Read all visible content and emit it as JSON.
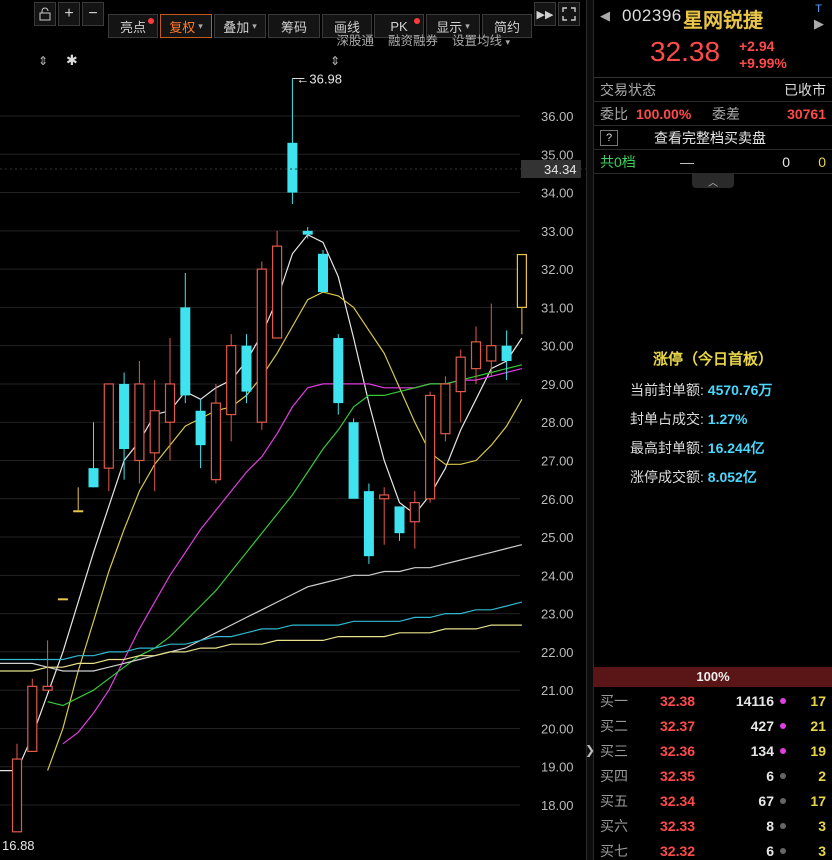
{
  "toolbar": {
    "buttons": [
      {
        "label": "亮点",
        "dot": true,
        "active": false,
        "caret": false
      },
      {
        "label": "复权",
        "dot": false,
        "active": true,
        "caret": true
      },
      {
        "label": "叠加",
        "dot": false,
        "active": false,
        "caret": true
      },
      {
        "label": "筹码",
        "dot": false,
        "active": false,
        "caret": false
      },
      {
        "label": "画线",
        "dot": false,
        "active": false,
        "caret": false
      },
      {
        "label": "PK",
        "dot": true,
        "active": false,
        "caret": false
      },
      {
        "label": "显示",
        "dot": false,
        "active": false,
        "caret": true
      },
      {
        "label": "简约",
        "dot": false,
        "active": false,
        "caret": false
      }
    ],
    "sub_links": [
      "深股通",
      "融资融券",
      "设置均线"
    ]
  },
  "chart_data": {
    "type": "candlestick",
    "y_axis_ticks": [
      36.0,
      35.0,
      34.0,
      33.0,
      32.0,
      31.0,
      30.0,
      29.0,
      28.0,
      27.0,
      26.0,
      25.0,
      24.0,
      23.0,
      22.0,
      21.0,
      20.0,
      19.0,
      18.0
    ],
    "ylim": [
      17.3,
      38.25
    ],
    "current_price_marker": "34.34",
    "high_annotation": "36.98",
    "low_label": "16.88",
    "colors": {
      "up": "#ff4a4a",
      "down": "#3fe3ef",
      "flat": "#e8c547",
      "ma5": "#e6e6e6",
      "ma10": "#d8c84a",
      "ma20": "#e03ee0",
      "ma30": "#37c83a",
      "ma60": "#d0d0d0",
      "ma120": "#2fb8cf",
      "ma250": "#e8e18c"
    },
    "candles": [
      {
        "o": 17.3,
        "h": 19.6,
        "l": 17.3,
        "c": 19.2
      },
      {
        "o": 19.4,
        "h": 21.3,
        "l": 19.4,
        "c": 21.1
      },
      {
        "o": 21.0,
        "h": 22.3,
        "l": 21.0,
        "c": 21.1
      },
      {
        "o": 23.4,
        "h": 23.4,
        "l": 23.4,
        "c": 23.4
      },
      {
        "o": 25.7,
        "h": 26.3,
        "l": 25.7,
        "c": 25.7
      },
      {
        "o": 26.8,
        "h": 28.0,
        "l": 26.3,
        "c": 26.3
      },
      {
        "o": 26.8,
        "h": 28.3,
        "l": 26.2,
        "c": 29.0
      },
      {
        "o": 29.0,
        "h": 29.3,
        "l": 26.5,
        "c": 27.3
      },
      {
        "o": 27.0,
        "h": 29.6,
        "l": 26.4,
        "c": 29.0
      },
      {
        "o": 27.2,
        "h": 29.1,
        "l": 26.2,
        "c": 28.3
      },
      {
        "o": 28.0,
        "h": 30.2,
        "l": 27.0,
        "c": 29.0
      },
      {
        "o": 31.0,
        "h": 31.9,
        "l": 28.5,
        "c": 28.7
      },
      {
        "o": 28.3,
        "h": 28.6,
        "l": 26.8,
        "c": 27.4
      },
      {
        "o": 26.5,
        "h": 29.0,
        "l": 26.4,
        "c": 28.5
      },
      {
        "o": 28.2,
        "h": 30.3,
        "l": 27.5,
        "c": 30.0
      },
      {
        "o": 30.0,
        "h": 30.3,
        "l": 28.5,
        "c": 28.8
      },
      {
        "o": 28.0,
        "h": 32.2,
        "l": 27.8,
        "c": 32.0
      },
      {
        "o": 30.2,
        "h": 33.0,
        "l": 30.2,
        "c": 32.6
      },
      {
        "o": 35.3,
        "h": 36.98,
        "l": 33.7,
        "c": 34.0
      },
      {
        "o": 33.0,
        "h": 33.1,
        "l": 32.8,
        "c": 32.9
      },
      {
        "o": 32.4,
        "h": 32.5,
        "l": 31.4,
        "c": 31.4
      },
      {
        "o": 30.2,
        "h": 30.3,
        "l": 28.2,
        "c": 28.5
      },
      {
        "o": 28.0,
        "h": 28.1,
        "l": 26.2,
        "c": 26.0
      },
      {
        "o": 26.2,
        "h": 26.4,
        "l": 24.3,
        "c": 24.5
      },
      {
        "o": 26.0,
        "h": 26.3,
        "l": 24.8,
        "c": 26.1
      },
      {
        "o": 25.8,
        "h": 25.8,
        "l": 24.9,
        "c": 25.1
      },
      {
        "o": 25.4,
        "h": 26.2,
        "l": 24.7,
        "c": 25.9
      },
      {
        "o": 26.0,
        "h": 28.8,
        "l": 25.9,
        "c": 28.7
      },
      {
        "o": 27.7,
        "h": 29.2,
        "l": 27.5,
        "c": 29.0
      },
      {
        "o": 28.8,
        "h": 29.9,
        "l": 28.0,
        "c": 29.7
      },
      {
        "o": 29.4,
        "h": 30.5,
        "l": 29.0,
        "c": 30.1
      },
      {
        "o": 29.6,
        "h": 31.1,
        "l": 29.2,
        "c": 30.0
      },
      {
        "o": 30.0,
        "h": 30.4,
        "l": 29.1,
        "c": 29.6
      },
      {
        "o": 31.0,
        "h": 32.38,
        "l": 30.3,
        "c": 32.38
      }
    ],
    "moving_averages": [
      {
        "name": "MA5",
        "color": "#e6e6e6",
        "values": [
          18.9,
          19.8,
          20.9,
          22.0,
          23.3,
          24.6,
          25.8,
          27.0,
          27.5,
          28.2,
          28.3,
          28.8,
          28.6,
          28.9,
          29.1,
          29.6,
          30.3,
          31.2,
          32.4,
          32.9,
          32.7,
          31.8,
          30.2,
          28.5,
          27.0,
          25.9,
          25.6,
          26.1,
          26.8,
          27.8,
          28.6,
          29.4,
          29.6,
          30.2
        ]
      },
      {
        "name": "MA10",
        "color": "#d8c84a",
        "values": [
          null,
          null,
          18.9,
          20.0,
          21.5,
          22.8,
          24.1,
          25.2,
          26.2,
          26.9,
          27.4,
          27.9,
          28.1,
          28.3,
          28.4,
          28.7,
          29.2,
          29.8,
          30.5,
          31.2,
          31.4,
          31.3,
          31.0,
          30.4,
          29.8,
          28.9,
          28.0,
          27.2,
          26.9,
          26.9,
          27.0,
          27.4,
          27.9,
          28.6
        ]
      },
      {
        "name": "MA20",
        "color": "#e03ee0",
        "values": [
          null,
          null,
          null,
          19.6,
          19.9,
          20.4,
          21.0,
          21.8,
          22.6,
          23.3,
          24.0,
          24.6,
          25.2,
          25.7,
          26.2,
          26.7,
          27.1,
          27.7,
          28.4,
          28.9,
          29.0,
          29.0,
          29.0,
          29.0,
          28.9,
          28.9,
          28.9,
          29.0,
          29.0,
          29.1,
          29.1,
          29.2,
          29.3,
          29.4
        ]
      },
      {
        "name": "MA30",
        "color": "#37c83a",
        "values": [
          null,
          null,
          20.7,
          20.6,
          20.8,
          21.0,
          21.3,
          21.6,
          21.9,
          22.1,
          22.4,
          22.8,
          23.2,
          23.6,
          24.1,
          24.6,
          25.1,
          25.6,
          26.1,
          26.7,
          27.3,
          27.8,
          28.4,
          28.7,
          28.7,
          28.8,
          28.9,
          29.0,
          29.0,
          29.1,
          29.2,
          29.3,
          29.4,
          29.5
        ]
      },
      {
        "name": "MA60",
        "color": "#d0d0d0",
        "values": [
          21.7,
          21.7,
          21.6,
          21.5,
          21.5,
          21.5,
          21.6,
          21.7,
          21.8,
          21.9,
          22.0,
          22.1,
          22.3,
          22.5,
          22.7,
          22.9,
          23.1,
          23.3,
          23.5,
          23.7,
          23.8,
          23.9,
          24.0,
          24.0,
          24.1,
          24.1,
          24.2,
          24.2,
          24.3,
          24.4,
          24.5,
          24.6,
          24.7,
          24.8
        ]
      },
      {
        "name": "MA120",
        "color": "#2fb8cf",
        "values": [
          21.8,
          21.8,
          21.8,
          21.8,
          21.9,
          21.9,
          22.0,
          22.0,
          22.1,
          22.1,
          22.2,
          22.2,
          22.3,
          22.4,
          22.4,
          22.5,
          22.6,
          22.6,
          22.7,
          22.7,
          22.7,
          22.7,
          22.8,
          22.8,
          22.8,
          22.8,
          22.9,
          22.9,
          23.0,
          23.0,
          23.1,
          23.1,
          23.2,
          23.3
        ]
      },
      {
        "name": "MA250",
        "color": "#e8e18c",
        "values": [
          21.5,
          21.5,
          21.6,
          21.6,
          21.7,
          21.7,
          21.8,
          21.8,
          21.9,
          21.9,
          22.0,
          22.0,
          22.1,
          22.1,
          22.2,
          22.2,
          22.2,
          22.3,
          22.3,
          22.3,
          22.3,
          22.4,
          22.4,
          22.4,
          22.4,
          22.5,
          22.5,
          22.5,
          22.6,
          22.6,
          22.6,
          22.7,
          22.7,
          22.7
        ]
      }
    ]
  },
  "quote": {
    "code": "002396",
    "name": "星网锐捷",
    "tag": "T",
    "price": "32.38",
    "change": "+2.94",
    "change_pct": "+9.99%",
    "status_label": "交易状态",
    "status_value": "已收市",
    "weibi_label": "委比",
    "weibi_value": "100.00%",
    "weicha_label": "委差",
    "weicha_value": "30761",
    "full_book_link": "查看完整档买卖盘",
    "q_mark": "?",
    "gong_label": "共0档",
    "gong_dash": "—",
    "gong_val_a": "0",
    "gong_val_b": "0"
  },
  "limit_up": {
    "title": "涨停（今日首板）",
    "rows": [
      {
        "label": "当前封单额:",
        "value": "4570.76万"
      },
      {
        "label": "封单占成交:",
        "value": "1.27%"
      },
      {
        "label": "最高封单额:",
        "value": "16.244亿"
      },
      {
        "label": "涨停成交额:",
        "value": "8.052亿"
      }
    ]
  },
  "order_book": {
    "bar_label": "100%",
    "bids": [
      {
        "label": "买一",
        "price": "32.38",
        "vol": "14116",
        "dot": "#e03ee0",
        "cnt": "17"
      },
      {
        "label": "买二",
        "price": "32.37",
        "vol": "427",
        "dot": "#e03ee0",
        "cnt": "21"
      },
      {
        "label": "买三",
        "price": "32.36",
        "vol": "134",
        "dot": "#e03ee0",
        "cnt": "19"
      },
      {
        "label": "买四",
        "price": "32.35",
        "vol": "6",
        "dot": "#666666",
        "cnt": "2"
      },
      {
        "label": "买五",
        "price": "32.34",
        "vol": "67",
        "dot": "#666666",
        "cnt": "17"
      },
      {
        "label": "买六",
        "price": "32.33",
        "vol": "8",
        "dot": "#666666",
        "cnt": "3"
      },
      {
        "label": "买七",
        "price": "32.32",
        "vol": "6",
        "dot": "#666666",
        "cnt": "3"
      }
    ]
  }
}
